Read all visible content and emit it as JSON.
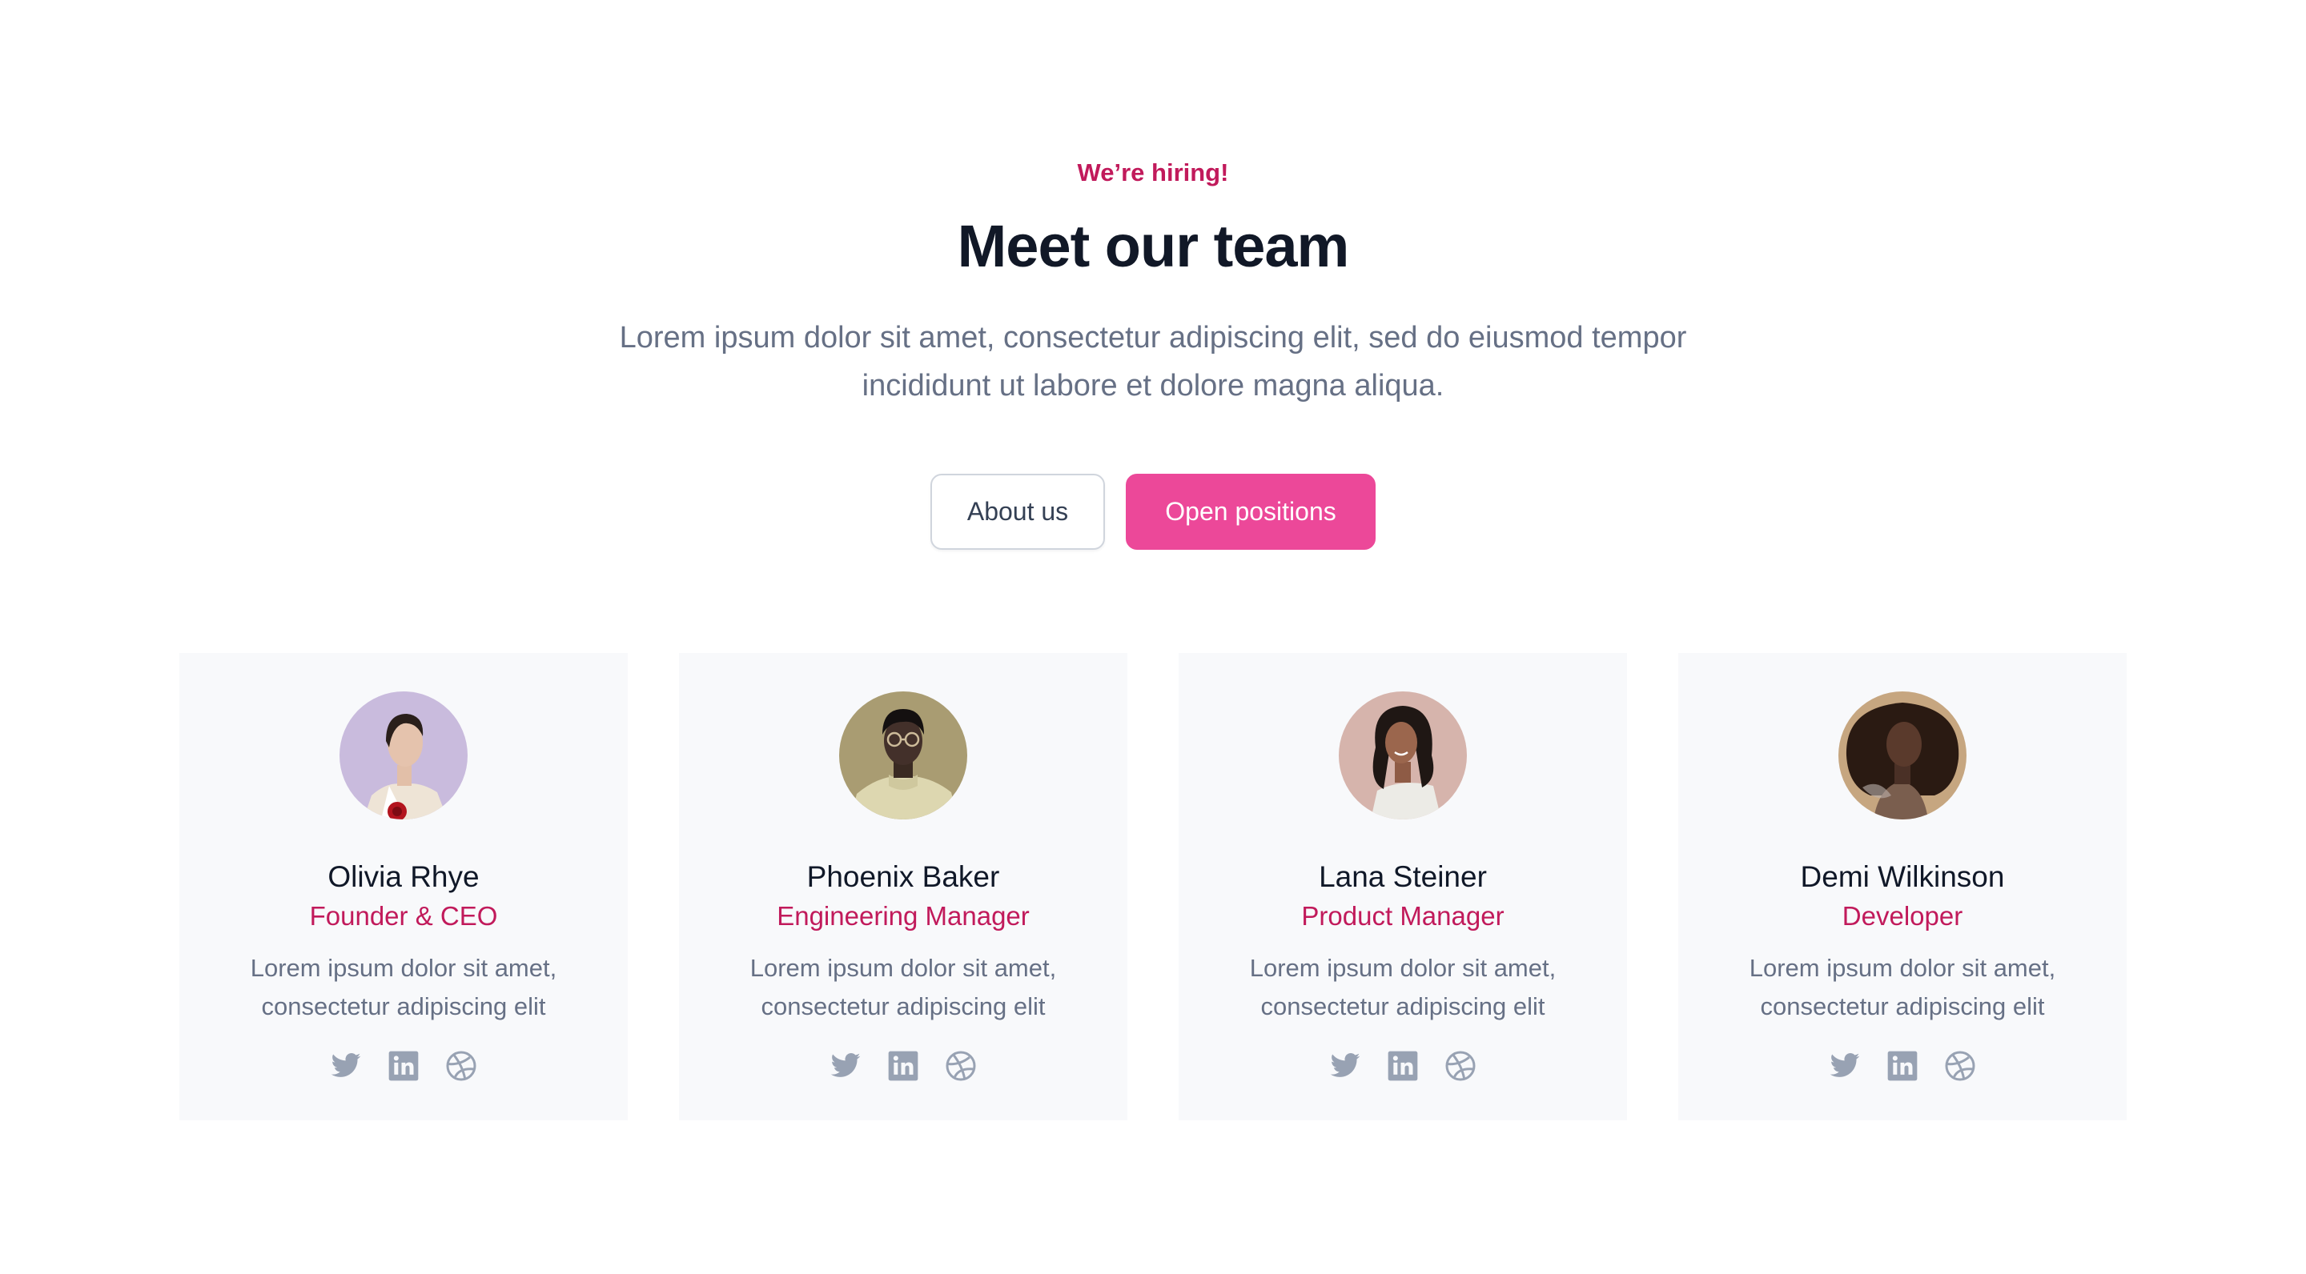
{
  "header": {
    "eyebrow": "We’re hiring!",
    "title": "Meet our team",
    "subtitle_line1": "Lorem ipsum dolor sit amet, consectetur adipiscing elit, sed do eiusmod tempor",
    "subtitle_line2": "incididunt ut labore et dolore magna aliqua."
  },
  "actions": {
    "secondary_label": "About us",
    "primary_label": "Open positions"
  },
  "colors": {
    "accent": "#c11a5b",
    "primary_button": "#ec4899",
    "heading": "#111827",
    "body_text": "#667085",
    "card_bg": "#f8f9fb",
    "icon": "#98a2b3"
  },
  "team": [
    {
      "name": "Olivia Rhye",
      "role": "Founder & CEO",
      "desc_line1": "Lorem ipsum dolor sit amet,",
      "desc_line2": "consectetur adipiscing elit",
      "avatar_bg": "#c9bbdd",
      "socials": [
        "twitter-icon",
        "linkedin-icon",
        "dribbble-icon"
      ]
    },
    {
      "name": "Phoenix Baker",
      "role": "Engineering Manager",
      "desc_line1": "Lorem ipsum dolor sit amet,",
      "desc_line2": "consectetur adipiscing elit",
      "avatar_bg": "#a99c72",
      "socials": [
        "twitter-icon",
        "linkedin-icon",
        "dribbble-icon"
      ]
    },
    {
      "name": "Lana Steiner",
      "role": "Product Manager",
      "desc_line1": "Lorem ipsum dolor sit amet,",
      "desc_line2": "consectetur adipiscing elit",
      "avatar_bg": "#d6b4ac",
      "socials": [
        "twitter-icon",
        "linkedin-icon",
        "dribbble-icon"
      ]
    },
    {
      "name": "Demi Wilkinson",
      "role": "Developer",
      "desc_line1": "Lorem ipsum dolor sit amet,",
      "desc_line2": "consectetur adipiscing elit",
      "avatar_bg": "#c6a680",
      "socials": [
        "twitter-icon",
        "linkedin-icon",
        "dribbble-icon"
      ]
    }
  ]
}
